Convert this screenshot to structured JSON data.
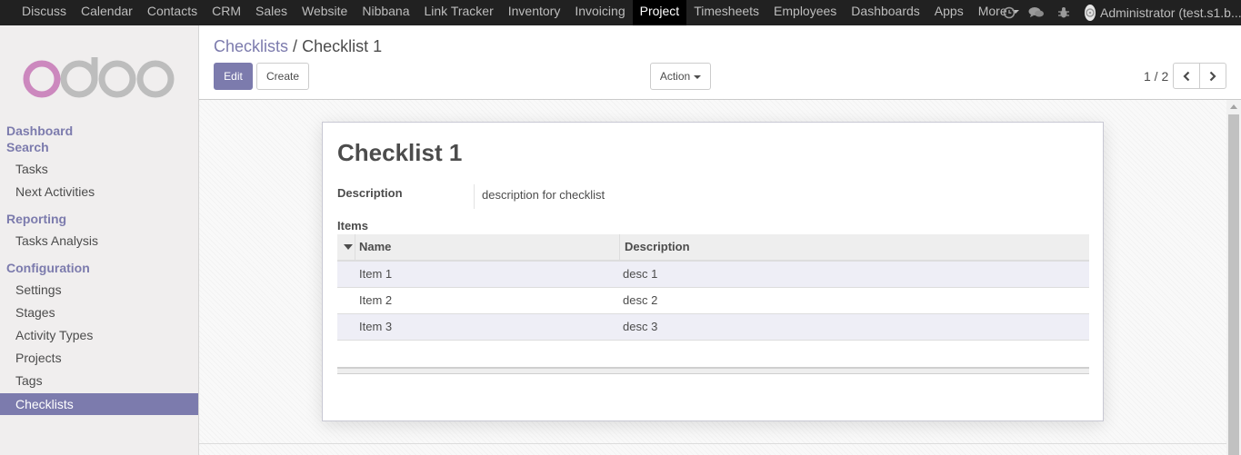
{
  "topbar": {
    "apps": [
      "Discuss",
      "Calendar",
      "Contacts",
      "CRM",
      "Sales",
      "Website",
      "Nibbana",
      "Link Tracker",
      "Inventory",
      "Invoicing",
      "Project",
      "Timesheets",
      "Employees",
      "Dashboards",
      "Apps"
    ],
    "active_app": "Project",
    "more_label": "More",
    "icons": [
      "clock-icon",
      "chat-icon",
      "bug-icon"
    ],
    "user_name": "Administrator (test.s1.b..."
  },
  "sidebar": {
    "logo_text": "odoo",
    "sections": [
      {
        "label": "Dashboard",
        "items": []
      },
      {
        "label": "Search",
        "items": [
          "Tasks",
          "Next Activities"
        ]
      },
      {
        "label": "Reporting",
        "items": [
          "Tasks Analysis"
        ]
      },
      {
        "label": "Configuration",
        "items": [
          "Settings",
          "Stages",
          "Activity Types",
          "Projects",
          "Tags",
          "Checklists"
        ]
      }
    ],
    "active_item": "Checklists"
  },
  "control_panel": {
    "breadcrumb_parent": "Checklists",
    "breadcrumb_sep": "/",
    "breadcrumb_current": "Checklist 1",
    "edit_label": "Edit",
    "create_label": "Create",
    "action_label": "Action",
    "pager": "1 / 2"
  },
  "form": {
    "title": "Checklist 1",
    "description_label": "Description",
    "description_value": "description for checklist",
    "items_label": "Items",
    "columns": [
      "Name",
      "Description"
    ],
    "rows": [
      {
        "name": "Item 1",
        "description": "desc 1"
      },
      {
        "name": "Item 2",
        "description": "desc 2"
      },
      {
        "name": "Item 3",
        "description": "desc 3"
      }
    ]
  },
  "colors": {
    "brand": "#7c7bad",
    "navbar": "#212121",
    "logo_o": "#cc88be",
    "logo_gray": "#bdbdbd"
  }
}
